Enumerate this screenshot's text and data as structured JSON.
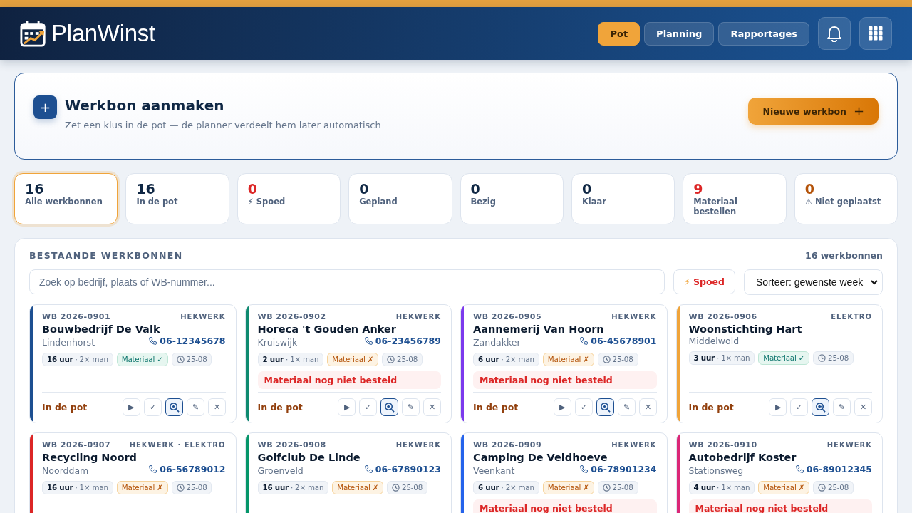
{
  "brand": {
    "name": "PlanWinst"
  },
  "nav": [
    {
      "label": "Pot",
      "selected": true
    },
    {
      "label": "Planning",
      "selected": false
    },
    {
      "label": "Rapportages",
      "selected": false
    }
  ],
  "create": {
    "title": "Werkbon aanmaken",
    "subtitle": "Zet een klus in de pot — de planner verdeelt hem later automatisch",
    "button": "Nieuwe werkbon",
    "button_icon": "+",
    "icon": "+"
  },
  "stats": [
    {
      "value": "16",
      "label": "Alle werkbonnen",
      "color": "#0f2744",
      "selected": true
    },
    {
      "value": "16",
      "label": "In de pot",
      "color": "#0f2744",
      "selected": false
    },
    {
      "value": "0",
      "label": "⚡ Spoed",
      "color": "#dc2626",
      "selected": false
    },
    {
      "value": "0",
      "label": "Gepland",
      "color": "#0f2744",
      "selected": false
    },
    {
      "value": "0",
      "label": "Bezig",
      "color": "#0f2744",
      "selected": false
    },
    {
      "value": "0",
      "label": "Klaar",
      "color": "#0f2744",
      "selected": false
    },
    {
      "value": "9",
      "label": "Materiaal bestellen",
      "color": "#dc2626",
      "selected": false
    },
    {
      "value": "0",
      "label": "⚠ Niet geplaatst",
      "color": "#b45309",
      "selected": false
    }
  ],
  "list": {
    "title": "BESTAANDE WERKBONNEN",
    "count": "16 werkbonnen",
    "search": {
      "placeholder": "Zoek op bedrijf, plaats of WB-nummer..."
    },
    "urgent_filter": {
      "icon": "⚡",
      "label": "Spoed",
      "selected": false
    },
    "sort": {
      "value": "Sorteer: gewenste week"
    }
  },
  "cards": [
    {
      "number": "WB 2026-0901",
      "category": "HEKWERK",
      "company": "Bouwbedrijf De Valk",
      "place": "Lindenhorst",
      "phone": "06-12345678",
      "effort": "**16 uur** · 2× man",
      "material": {
        "label": "Materiaal ✓",
        "ordered": true
      },
      "date": "25-08",
      "status": "In de pot",
      "color": "#1d4f91",
      "actions": [
        {
          "kind": "text",
          "label": "▶"
        },
        {
          "kind": "text",
          "label": "✓"
        },
        {
          "kind": "zoom"
        },
        {
          "kind": "text",
          "label": "✎"
        },
        {
          "kind": "text",
          "label": "✕"
        }
      ]
    },
    {
      "number": "WB 2026-0902",
      "category": "HEKWERK",
      "company": "Horeca 't Gouden Anker",
      "place": "Kruiswijk",
      "phone": "06-23456789",
      "effort": "**2 uur** · 1× man",
      "material": {
        "label": "Materiaal ✗",
        "ordered": false
      },
      "date": "25-08",
      "warning": "Materiaal nog niet besteld",
      "status": "In de pot",
      "color": "#0f8a6f",
      "actions": [
        {
          "kind": "text",
          "label": "▶"
        },
        {
          "kind": "text",
          "label": "✓"
        },
        {
          "kind": "zoom"
        },
        {
          "kind": "text",
          "label": "✎"
        },
        {
          "kind": "text",
          "label": "✕"
        }
      ]
    },
    {
      "number": "WB 2026-0905",
      "category": "HEKWERK",
      "company": "Aannemerij Van Hoorn",
      "place": "Zandakker",
      "phone": "06-45678901",
      "effort": "**6 uur** · 2× man",
      "material": {
        "label": "Materiaal ✗",
        "ordered": false
      },
      "date": "25-08",
      "warning": "Materiaal nog niet besteld",
      "status": "In de pot",
      "color": "#7c3aed",
      "actions": [
        {
          "kind": "text",
          "label": "▶"
        },
        {
          "kind": "text",
          "label": "✓"
        },
        {
          "kind": "zoom"
        },
        {
          "kind": "text",
          "label": "✎"
        },
        {
          "kind": "text",
          "label": "✕"
        }
      ]
    },
    {
      "number": "WB 2026-0906",
      "category": "ELEKTRO",
      "company": "Woonstichting Hart",
      "place": "Middelwold",
      "effort": "**3 uur** · 1× man",
      "material": {
        "label": "Materiaal ✓",
        "ordered": true
      },
      "date": "25-08",
      "status": "In de pot",
      "color": "#f0a43a",
      "actions": [
        {
          "kind": "text",
          "label": "▶"
        },
        {
          "kind": "text",
          "label": "✓"
        },
        {
          "kind": "zoom"
        },
        {
          "kind": "text",
          "label": "✎"
        },
        {
          "kind": "text",
          "label": "✕"
        }
      ]
    },
    {
      "number": "WB 2026-0907",
      "category": "HEKWERK · ELEKTRO",
      "company": "Recycling Noord",
      "place": "Noorddam",
      "phone": "06-56789012",
      "effort": "**16 uur** · 1× man",
      "material": {
        "label": "Materiaal ✗",
        "ordered": false
      },
      "date": "25-08",
      "color": "#dc2626"
    },
    {
      "number": "WB 2026-0908",
      "category": "HEKWERK",
      "company": "Golfclub De Linde",
      "place": "Groenveld",
      "phone": "06-67890123",
      "effort": "**16 uur** · 2× man",
      "material": {
        "label": "Materiaal ✗",
        "ordered": false
      },
      "date": "25-08",
      "color": "#059669"
    },
    {
      "number": "WB 2026-0909",
      "category": "HEKWERK",
      "company": "Camping De Veldhoeve",
      "place": "Veenkant",
      "phone": "06-78901234",
      "effort": "**6 uur** · 2× man",
      "material": {
        "label": "Materiaal ✗",
        "ordered": false
      },
      "date": "25-08",
      "warning": "Materiaal nog niet besteld",
      "color": "#2563eb"
    },
    {
      "number": "WB 2026-0910",
      "category": "HEKWERK",
      "company": "Autobedrijf Koster",
      "place": "Stationsweg",
      "phone": "06-89012345",
      "effort": "**4 uur** · 1× man",
      "material": {
        "label": "Materiaal ✗",
        "ordered": false
      },
      "date": "25-08",
      "warning": "Materiaal nog niet besteld",
      "color": "#db2777"
    }
  ]
}
